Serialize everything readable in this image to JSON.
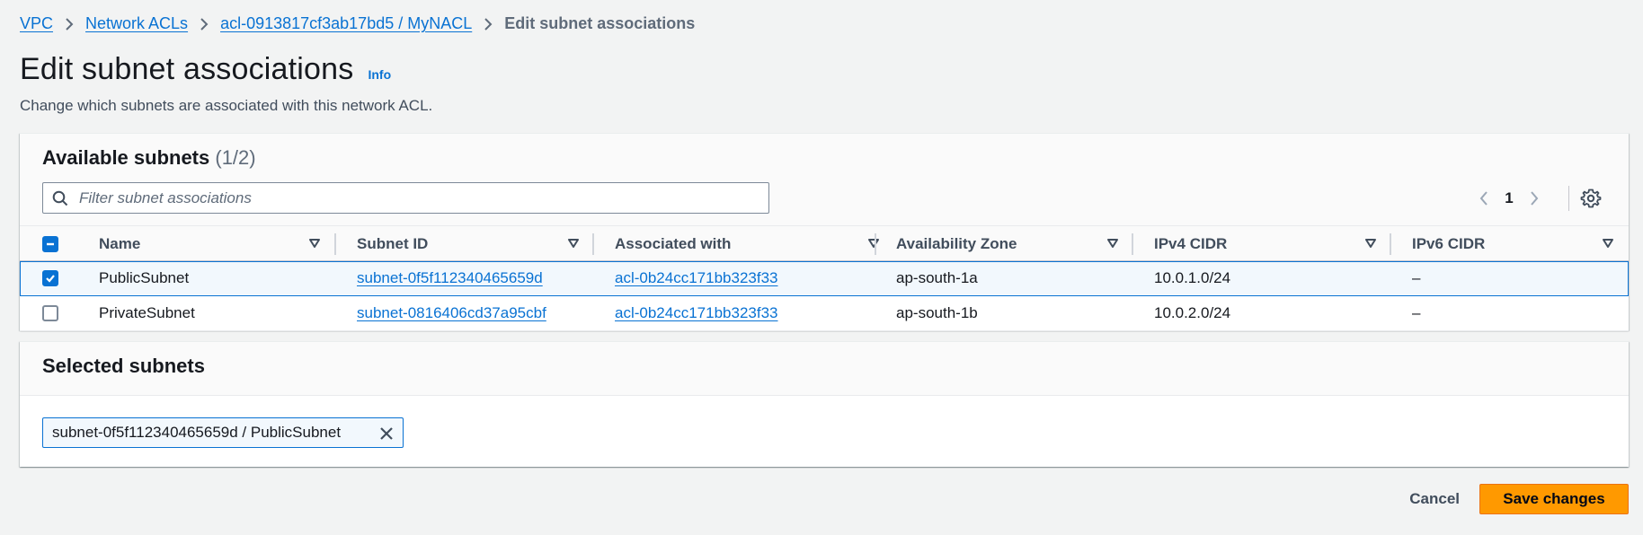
{
  "breadcrumb": {
    "items": [
      "VPC",
      "Network ACLs",
      "acl-0913817cf3ab17bd5 / MyNACL"
    ],
    "current": "Edit subnet associations"
  },
  "header": {
    "title": "Edit subnet associations",
    "info_label": "Info",
    "description": "Change which subnets are associated with this network ACL."
  },
  "available": {
    "title": "Available subnets",
    "count": "(1/2)",
    "search_placeholder": "Filter subnet associations",
    "page": "1",
    "columns": [
      "Name",
      "Subnet ID",
      "Associated with",
      "Availability Zone",
      "IPv4 CIDR",
      "IPv6 CIDR"
    ],
    "rows": [
      {
        "checked": true,
        "name": "PublicSubnet",
        "subnet_id": "subnet-0f5f112340465659d",
        "associated_with": "acl-0b24cc171bb323f33",
        "az": "ap-south-1a",
        "ipv4": "10.0.1.0/24",
        "ipv6": "–"
      },
      {
        "checked": false,
        "name": "PrivateSubnet",
        "subnet_id": "subnet-0816406cd37a95cbf",
        "associated_with": "acl-0b24cc171bb323f33",
        "az": "ap-south-1b",
        "ipv4": "10.0.2.0/24",
        "ipv6": "–"
      }
    ]
  },
  "selected": {
    "title": "Selected subnets",
    "tokens": [
      "subnet-0f5f112340465659d / PublicSubnet"
    ]
  },
  "actions": {
    "cancel_label": "Cancel",
    "save_label": "Save changes"
  },
  "colors": {
    "link": "#0972d3",
    "primary_button": "#ff9900",
    "background": "#f2f3f3"
  }
}
